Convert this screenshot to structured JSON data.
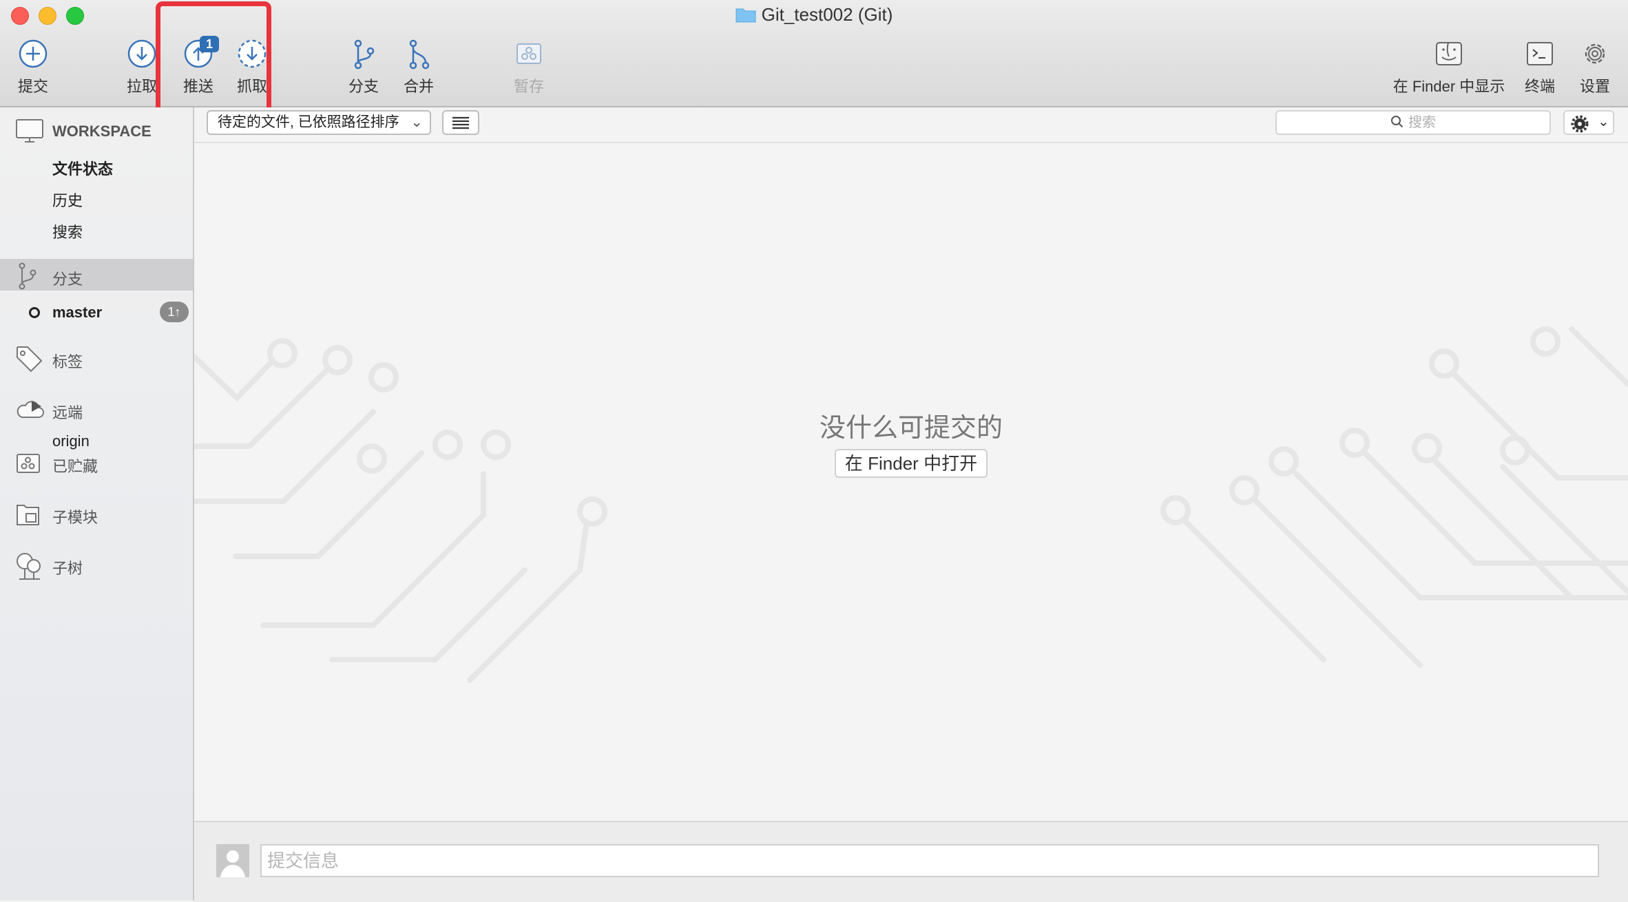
{
  "window": {
    "title": "Git_test002 (Git)"
  },
  "toolbar": {
    "commit": "提交",
    "pull": "拉取",
    "push": "推送",
    "push_badge": "1",
    "fetch": "抓取",
    "branch": "分支",
    "merge": "合并",
    "stash": "暂存",
    "show_in_finder": "在 Finder 中显示",
    "terminal": "终端",
    "settings": "设置"
  },
  "sidebar": {
    "workspace": {
      "title": "WORKSPACE",
      "items": [
        "文件状态",
        "历史",
        "搜索"
      ],
      "selected": "文件状态"
    },
    "branches": {
      "title": "分支",
      "current": "master",
      "ahead": "1↑"
    },
    "tags": {
      "title": "标签"
    },
    "remotes": {
      "title": "远端",
      "items": [
        "origin"
      ]
    },
    "stashes": {
      "title": "已贮藏"
    },
    "submodules": {
      "title": "子模块"
    },
    "subtrees": {
      "title": "子树"
    }
  },
  "filter": {
    "sort_value": "待定的文件, 已依照路径排序",
    "search_placeholder": "搜索"
  },
  "main": {
    "empty_message": "没什么可提交的",
    "open_in_finder": "在 Finder 中打开"
  },
  "commit": {
    "placeholder": "提交信息"
  },
  "colors": {
    "accent": "#3a74b8",
    "highlight": "#e8333d",
    "close": "#fc5f57",
    "minimize": "#fdbc2e",
    "zoom": "#28c840"
  }
}
